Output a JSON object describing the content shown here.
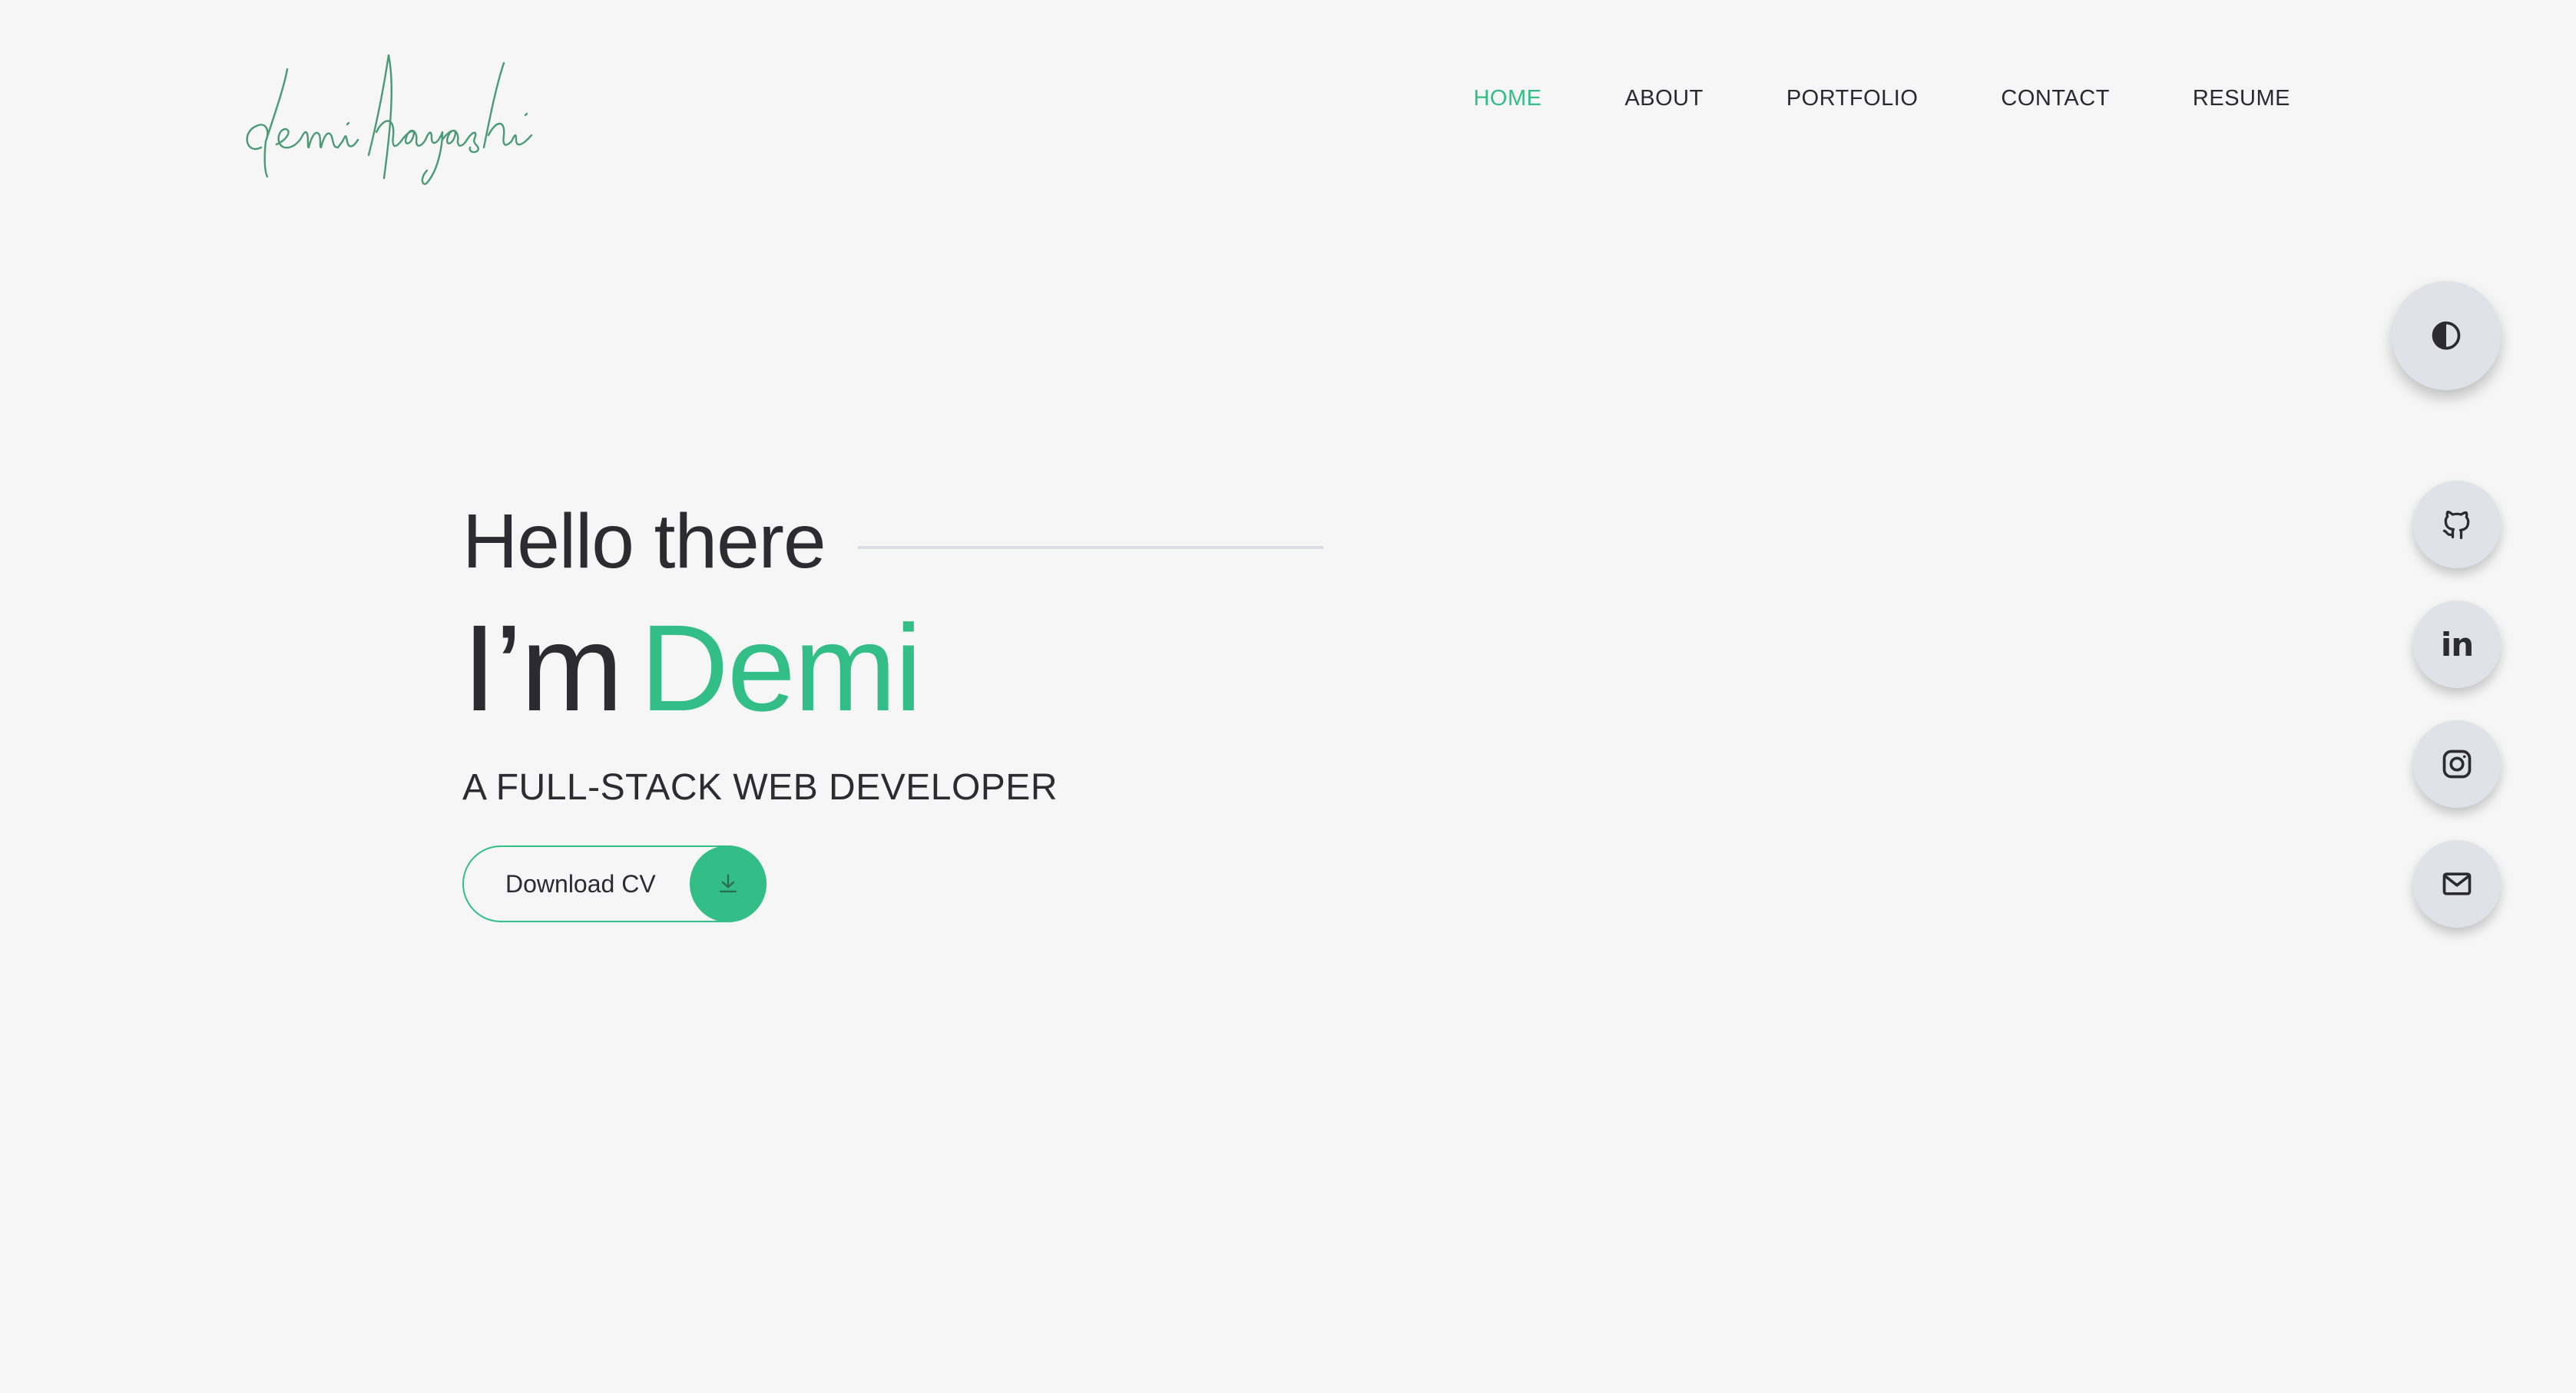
{
  "logo": {
    "text": "demi hayashi",
    "color": "#4a9a76"
  },
  "nav": {
    "items": [
      {
        "label": "HOME",
        "active": true
      },
      {
        "label": "ABOUT",
        "active": false
      },
      {
        "label": "PORTFOLIO",
        "active": false
      },
      {
        "label": "CONTACT",
        "active": false
      },
      {
        "label": "RESUME",
        "active": false
      }
    ]
  },
  "hero": {
    "greeting": "Hello there",
    "headline_prefix": "I’m",
    "headline_name": "Demi",
    "subtitle": "A FULL-STACK WEB DEVELOPER",
    "cv_button_label": "Download CV",
    "cv_button_icon": "download-icon"
  },
  "theme_toggle": {
    "icon": "half-circle-contrast-icon"
  },
  "social": [
    {
      "name": "github",
      "icon": "github-icon"
    },
    {
      "name": "linkedin",
      "icon": "linkedin-icon",
      "glyph": "in"
    },
    {
      "name": "instagram",
      "icon": "instagram-icon"
    },
    {
      "name": "email",
      "icon": "mail-icon"
    }
  ],
  "colors": {
    "accent": "#32be86",
    "background": "#f6f6f6",
    "text": "#2b2b31",
    "button_bg": "#dfe2e8",
    "divider": "#dcdde6"
  }
}
